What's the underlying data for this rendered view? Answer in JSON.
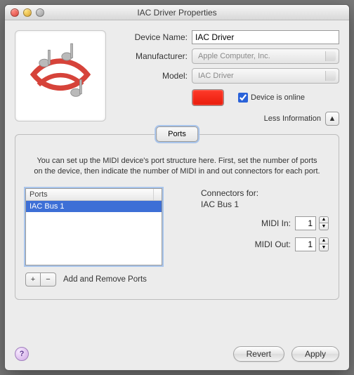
{
  "window": {
    "title": "IAC Driver Properties"
  },
  "labels": {
    "device_name": "Device Name:",
    "manufacturer": "Manufacturer:",
    "model": "Model:",
    "online": "Device is online",
    "less_info": "Less Information",
    "ports_tab": "Ports",
    "ports_help_line1": "You can set up the MIDI device's port structure here.  First, set the number of ports",
    "ports_help_line2": "on the device, then indicate the number of MIDI in and out connectors for each port.",
    "ports_header": "Ports",
    "add_remove": "Add and Remove Ports",
    "connectors_for": "Connectors for:",
    "midi_in": "MIDI In:",
    "midi_out": "MIDI Out:",
    "revert": "Revert",
    "apply": "Apply"
  },
  "values": {
    "device_name": "IAC Driver",
    "manufacturer": "Apple Computer, Inc.",
    "model": "IAC Driver",
    "online": true,
    "swatch_color": "#f01c0c",
    "selected_port": "IAC Bus 1",
    "midi_in": "1",
    "midi_out": "1"
  },
  "ports": {
    "items": [
      {
        "label": "IAC Bus 1",
        "selected": true
      }
    ]
  },
  "icons": {
    "app_icon": "music-swirl-icon",
    "close": "close-icon",
    "minimize": "minimize-icon",
    "zoom": "zoom-icon",
    "disclosure": "triangle-up-icon",
    "add": "plus-icon",
    "remove": "minus-icon",
    "stepper_up": "chevron-up-icon",
    "stepper_down": "chevron-down-icon",
    "help": "help-icon"
  }
}
